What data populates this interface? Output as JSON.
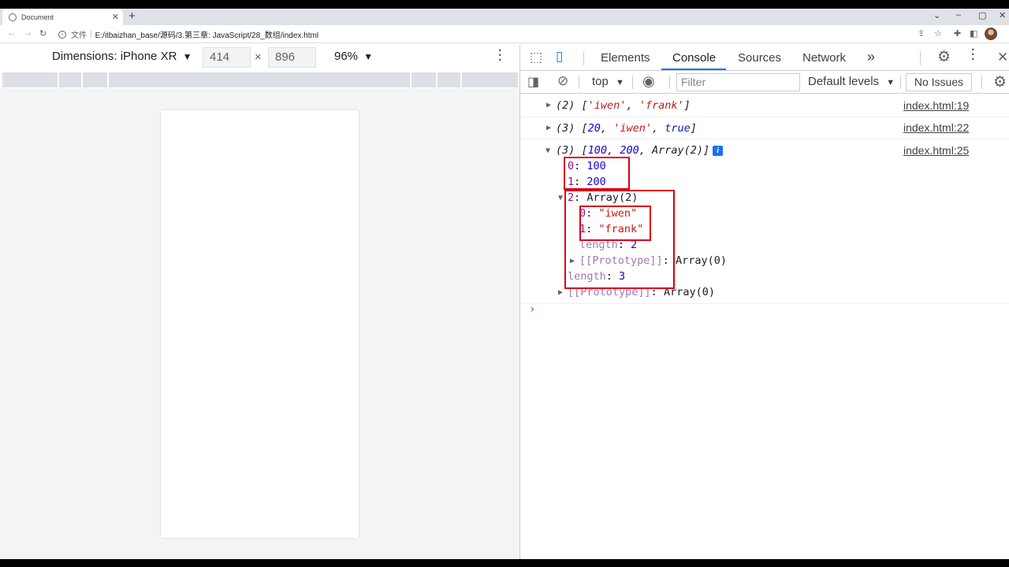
{
  "browser": {
    "tab_title": "Document",
    "tab_close": "✕",
    "new_tab": "+",
    "address": {
      "scheme_label": "文件",
      "separator": "|",
      "url": "E:/itbaizhan_base/源码/3.第三章: JavaScript/28_数组/index.html"
    }
  },
  "device_toolbar": {
    "dimensions_label": "Dimensions: iPhone XR",
    "width": "414",
    "times": "×",
    "height": "896",
    "zoom": "96%"
  },
  "devtools": {
    "tabs": [
      "Elements",
      "Console",
      "Sources",
      "Network"
    ],
    "active_tab": "Console",
    "more_tabs": "»",
    "context": "top",
    "filter_placeholder": "Filter",
    "levels": "Default levels",
    "no_issues": "No Issues"
  },
  "console": {
    "messages": [
      {
        "count": "(2)",
        "source": "index.html:19"
      },
      {
        "count": "(3)",
        "source": "index.html:22"
      },
      {
        "count": "(3)",
        "source": "index.html:25"
      }
    ],
    "values": {
      "iwen": "'iwen'",
      "frank": "'frank'",
      "n20": "20",
      "true_val": "true",
      "n100": "100",
      "n200": "200",
      "arr2": "Array(2)",
      "s_iwen": "\"iwen\"",
      "s_frank": "\"frank\"",
      "len2": "2",
      "len3": "3",
      "arr0": "Array(0)"
    },
    "keys": {
      "k0": "0",
      "k1": "1",
      "k2": "2",
      "length": "length",
      "proto": "[[Prototype]]"
    },
    "info_badge": "i",
    "prompt": "›"
  },
  "colors": {
    "accent": "#1a73e8",
    "string": "#c41a16",
    "number": "#1c00cf",
    "key": "#881391",
    "highlight_box": "#d9001b"
  }
}
